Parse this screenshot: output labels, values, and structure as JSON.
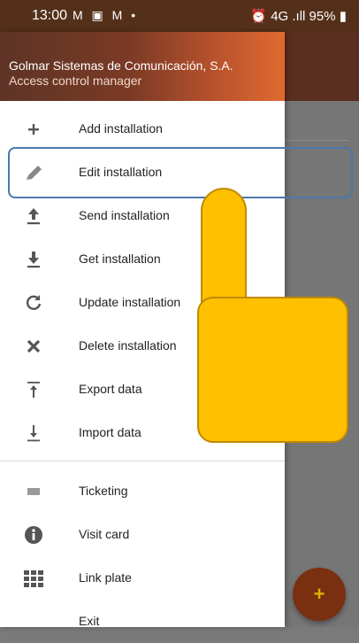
{
  "status_bar": {
    "time": "13:00",
    "icons": "M ▣ M •",
    "right": "⏰ 4G .ıll 95% ▮"
  },
  "drawer": {
    "header": {
      "company": "Golmar Sistemas de Comunicación, S.A.",
      "subtitle": "Access control manager"
    },
    "items": [
      {
        "label": "Add installation",
        "icon": "plus-icon"
      },
      {
        "label": "Edit installation",
        "icon": "pencil-icon"
      },
      {
        "label": "Send installation",
        "icon": "upload-icon"
      },
      {
        "label": "Get installation",
        "icon": "download-icon"
      },
      {
        "label": "Update installation",
        "icon": "refresh-icon"
      },
      {
        "label": "Delete installation",
        "icon": "close-icon"
      },
      {
        "label": "Export data",
        "icon": "export-icon"
      },
      {
        "label": "Import data",
        "icon": "import-icon"
      },
      {
        "label": "Ticketing",
        "icon": "ticket-icon"
      },
      {
        "label": "Visit card",
        "icon": "info-icon"
      },
      {
        "label": "Link plate",
        "icon": "grid-icon"
      },
      {
        "label": "Exit",
        "icon": "exit-icon"
      }
    ]
  },
  "fab": {
    "label": "+"
  },
  "colors": {
    "header_start": "#5e3426",
    "header_end": "#e06a30",
    "highlight": "#4a79ad",
    "pointer": "#ffc000"
  }
}
